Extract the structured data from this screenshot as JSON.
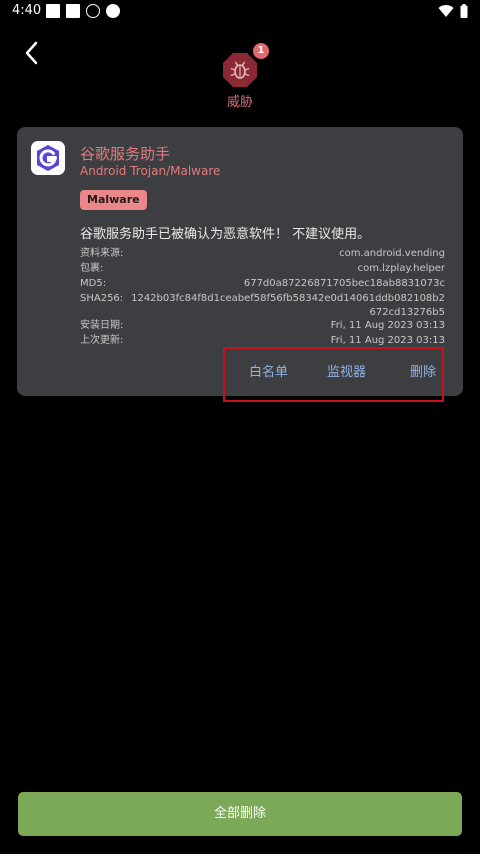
{
  "status_bar": {
    "time": "4:40",
    "left_icons": [
      "notification-square-icon",
      "notification-square-icon",
      "vpn-shield-icon",
      "face-icon"
    ],
    "right_icons": [
      "wifi-icon",
      "battery-icon"
    ]
  },
  "header": {
    "back_icon": "chevron-left-icon",
    "threat_count": "1",
    "threat_label": "威胁",
    "threat_color": "#d8717a"
  },
  "card": {
    "app_name": "谷歌服务助手",
    "app_type": "Android Trojan/Malware",
    "badge": "Malware",
    "warning": "谷歌服务助手已被确认为恶意软件！ 不建议使用。",
    "details": {
      "source_label": "资料来源:",
      "source_value": "com.android.vending",
      "package_label": "包裹:",
      "package_value": "com.lzplay.helper",
      "md5_label": "MD5:",
      "md5_value": "677d0a87226871705bec18ab8831073c",
      "sha256_label": "SHA256:",
      "sha256_value": "1242b03fc84f8d1ceabef58f56fb58342e0d14061ddb082108b2672cd13276b5",
      "install_label": "安装日期:",
      "install_value": "Fri, 11 Aug 2023 03:13",
      "update_label": "上次更新:",
      "update_value": "Fri, 11 Aug 2023 03:13"
    },
    "actions": {
      "whitelist": "白名单",
      "monitor": "监视器",
      "delete": "删除"
    }
  },
  "footer": {
    "delete_all": "全部删除",
    "button_color": "#7ba957"
  }
}
